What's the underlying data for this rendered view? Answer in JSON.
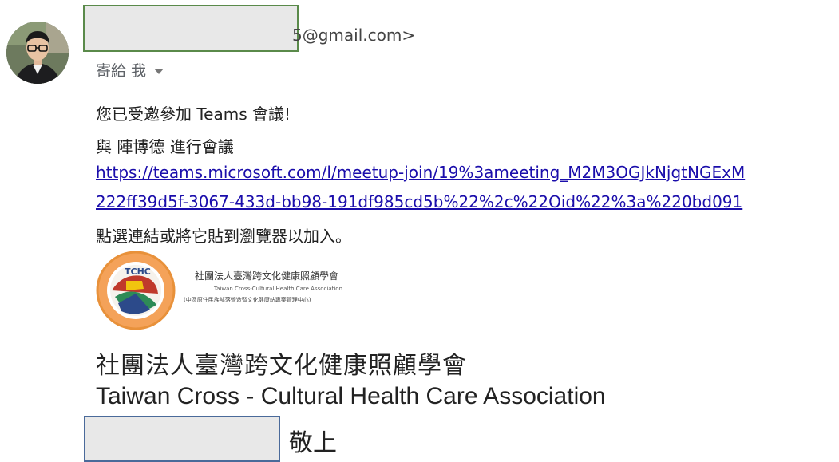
{
  "sender": {
    "email_suffix": "5@gmail.com>",
    "to_label": "寄給 我"
  },
  "message": {
    "line1": "您已受邀參加 Teams 會議!",
    "line2": "與 陣博德 進行會議",
    "link_line1": "https://teams.microsoft.com/l/meetup-join/19%3ameeting_M2M3OGJkNjgtNGExM",
    "link_line2": "222ff39d5f-3067-433d-bb98-191df985cd5b%22%2c%22Oid%22%3a%220bd091",
    "instruction": "點選連結或將它貼到瀏覽器以加入。"
  },
  "logo": {
    "name_zh": "社團法人臺灣跨文化健康照顧學會",
    "name_en": "Taiwan Cross-Cultural Health Care Association",
    "subtitle": "(中區原住民族部落營造暨文化健康站專案管理中心)",
    "ring_color": "#e8913a"
  },
  "signature": {
    "org_zh": "社團法人臺灣跨文化健康照顧學會",
    "org_en": "Taiwan Cross - Cultural Health Care Association",
    "closing": "敬上"
  }
}
